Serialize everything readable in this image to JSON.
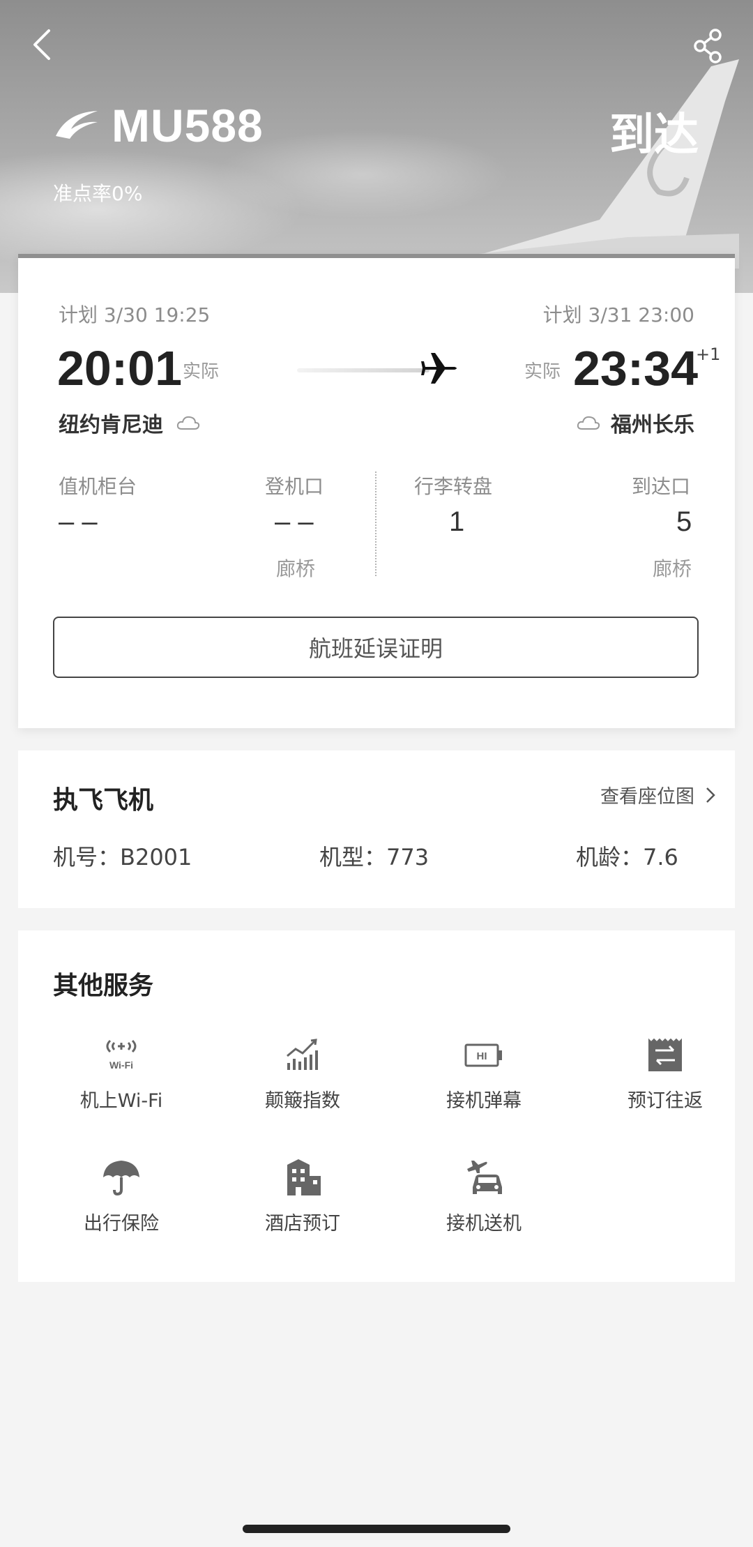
{
  "header": {
    "flight_number": "MU588",
    "on_time_rate": "准点率0%",
    "status": "到达"
  },
  "flight": {
    "departure": {
      "planned": "计划 3/30 19:25",
      "actual_time": "20:01",
      "actual_label": "实际",
      "city": "纽约肯尼迪",
      "weather_icon": "cloud-icon"
    },
    "arrival": {
      "planned": "计划 3/31 23:00",
      "actual_time": "23:34",
      "actual_label": "实际",
      "day_offset": "+1",
      "city": "福州长乐",
      "weather_icon": "cloud-icon"
    },
    "info": {
      "checkin_label": "值机柜台",
      "checkin_value": "– –",
      "gate_label": "登机口",
      "gate_value": "– –",
      "gate_sub": "廊桥",
      "baggage_label": "行李转盘",
      "baggage_value": "1",
      "exit_label": "到达口",
      "exit_value": "5",
      "exit_sub": "廊桥"
    },
    "delay_certificate_button": "航班延误证明"
  },
  "aircraft": {
    "title": "执飞飞机",
    "seat_map_link": "查看座位图",
    "registration": "机号：B2001",
    "model": "机型：773",
    "age": "机龄：7.6"
  },
  "services": {
    "title": "其他服务",
    "items": [
      {
        "label": "机上Wi-Fi",
        "icon": "wifi-icon"
      },
      {
        "label": "颠簸指数",
        "icon": "turbulence-chart-icon"
      },
      {
        "label": "接机弹幕",
        "icon": "message-board-icon"
      },
      {
        "label": "预订往返",
        "icon": "round-trip-ticket-icon"
      },
      {
        "label": "出行保险",
        "icon": "umbrella-icon"
      },
      {
        "label": "酒店预订",
        "icon": "hotel-icon"
      },
      {
        "label": "接机送机",
        "icon": "car-plane-icon"
      }
    ],
    "wifi_icon_text": "Wi-Fi",
    "board_icon_text": "HI"
  },
  "colors": {
    "header_bg": "#9a9a9a",
    "card_bg": "#ffffff",
    "page_bg": "#f4f4f4",
    "text_primary": "#222222"
  }
}
